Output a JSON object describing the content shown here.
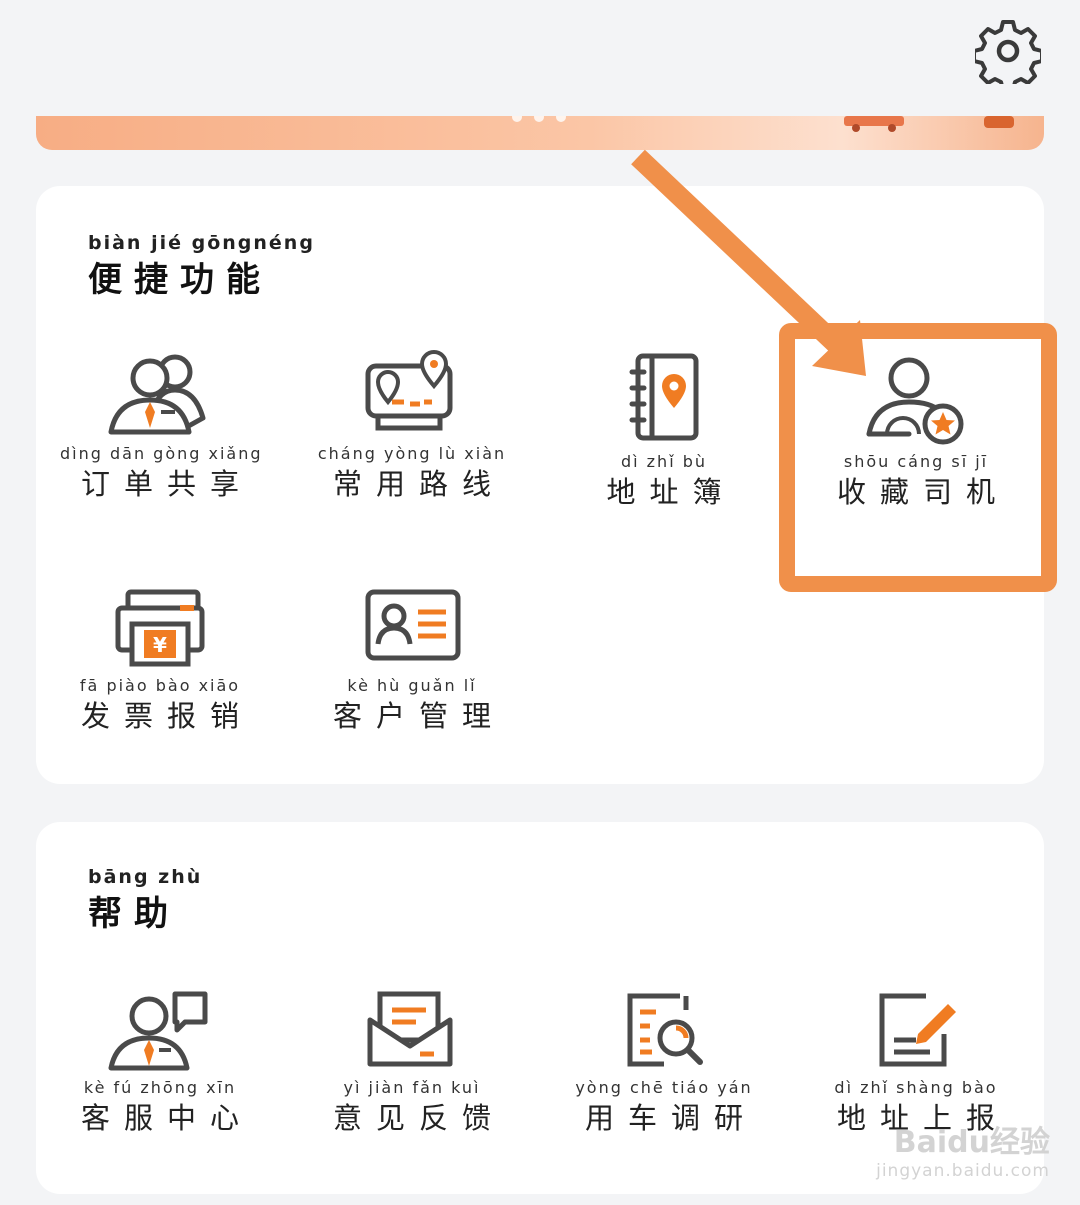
{
  "sections": {
    "functions": {
      "title_pinyin": "biàn  jié  gōngnéng",
      "title": "便捷功能",
      "items": [
        {
          "pinyin": "dìng  dān  gòng xiǎng",
          "label": "订单共享",
          "icon": "share-order-icon"
        },
        {
          "pinyin": "cháng yòng  lù  xiàn",
          "label": "常用路线",
          "icon": "route-map-icon"
        },
        {
          "pinyin": "dì  zhǐ  bù",
          "label": "地址簿",
          "icon": "address-book-icon"
        },
        {
          "pinyin": "shōu cáng  sī  jī",
          "label": "收藏司机",
          "icon": "favorite-driver-icon"
        },
        {
          "pinyin": "fā  piào  bào  xiāo",
          "label": "发票报销",
          "icon": "invoice-icon"
        },
        {
          "pinyin": "kè  hù  guǎn  lǐ",
          "label": "客户管理",
          "icon": "customer-card-icon"
        }
      ]
    },
    "help": {
      "title_pinyin": "bāng zhù",
      "title": "帮助",
      "items": [
        {
          "pinyin": "kè  fú  zhōng  xīn",
          "label": "客服中心",
          "icon": "customer-service-icon"
        },
        {
          "pinyin": "yì  jiàn  fǎn  kuì",
          "label": "意见反馈",
          "icon": "feedback-mail-icon"
        },
        {
          "pinyin": "yòng  chē  tiáo  yán",
          "label": "用车调研",
          "icon": "survey-icon"
        },
        {
          "pinyin": "dì  zhǐ  shàng  bào",
          "label": "地址上报",
          "icon": "address-report-icon"
        }
      ]
    }
  },
  "watermark": {
    "brand": "Baidu经验",
    "url": "jingyan.baidu.com"
  },
  "colors": {
    "accent": "#f07c22",
    "highlight": "#f0904a",
    "icon_stroke": "#4a4a4a",
    "card": "#ffffff",
    "background": "#f3f4f6"
  }
}
